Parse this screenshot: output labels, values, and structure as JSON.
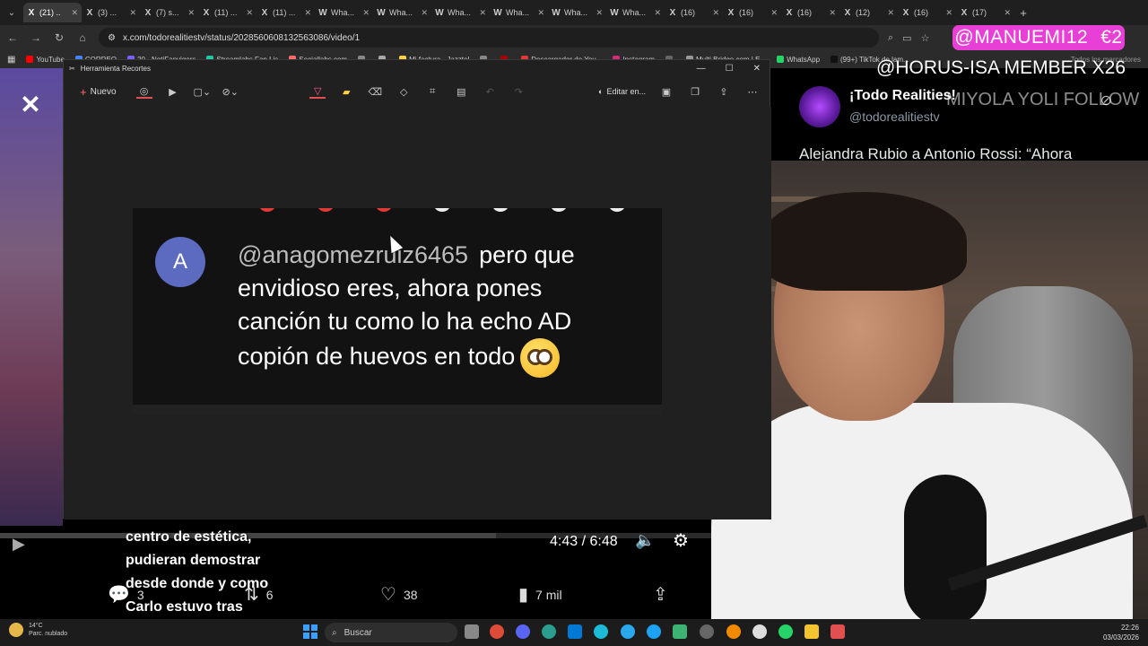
{
  "browser": {
    "tabs": [
      {
        "icon": "X",
        "label": "(21) ..",
        "active": true
      },
      {
        "icon": "X",
        "label": "(3) ..."
      },
      {
        "icon": "X",
        "label": "(7) s..."
      },
      {
        "icon": "X",
        "label": "(11) ..."
      },
      {
        "icon": "X",
        "label": "(11) ..."
      },
      {
        "icon": "W",
        "label": "Wha..."
      },
      {
        "icon": "W",
        "label": "Wha..."
      },
      {
        "icon": "W",
        "label": "Wha..."
      },
      {
        "icon": "W",
        "label": "Wha..."
      },
      {
        "icon": "W",
        "label": "Wha..."
      },
      {
        "icon": "W",
        "label": "Wha..."
      },
      {
        "icon": "X",
        "label": "(16)"
      },
      {
        "icon": "X",
        "label": "(16)"
      },
      {
        "icon": "X",
        "label": "(16)"
      },
      {
        "icon": "X",
        "label": "(12)"
      },
      {
        "icon": "X",
        "label": "(16)"
      },
      {
        "icon": "X",
        "label": "(17)"
      }
    ],
    "url": "x.com/todorealitiestv/status/2028560608132563086/video/1",
    "bookmarks": [
      "YouTube",
      "CORREO",
      "20 - NotiFanvigers",
      "Streamlabs Fan Lis",
      "Sociallabs.com",
      "",
      "",
      "Mi factura - Jazztel",
      "",
      "",
      "Descargador de You...",
      "Instagram",
      "",
      "Multi Bridge com | E...",
      "WhatsApp",
      "(99+) TikTok de lam..."
    ],
    "bookmarks_right": "Todos los marcadores"
  },
  "overlays": {
    "badge_user": "@MANUEMI12",
    "badge_amount": "€2",
    "member_line": "@HORUS-ISA  MEMBER X26",
    "follow_line": "MIYOLA YOLI  FOLLOW"
  },
  "snipping_tool": {
    "title": "Herramienta Recortes",
    "new_label": "Nuevo",
    "edit_label": "Editar en...",
    "comment": {
      "avatar_letter": "A",
      "handle": "@anagomezruiz6465",
      "line1": "pero que",
      "line2": "envidioso eres, ahora pones",
      "line3": "canción tu como lo ha echo AD",
      "line4": "copión de huevos en todo"
    }
  },
  "tweet": {
    "name": "¡Todo Realities!",
    "handle": "@todorealitiestv",
    "text": "Alejandra Rubio a Antonio Rossi: “Ahora"
  },
  "player": {
    "time": "4:43 / 6:48",
    "progress": 0.697,
    "subtitle": "centro de estética, pudieran demostrar desde donde y como Carlo estuvo tras Laura..ya veremos.",
    "replies": "3",
    "reposts": "6",
    "likes": "38",
    "views": "7 mil"
  },
  "taskbar": {
    "temp": "14°C",
    "weather": "Parc. nublado",
    "search": "Buscar",
    "time": "22:26",
    "date": "03/03/2026"
  },
  "colors": {
    "badge": "#e83fd6",
    "accent_blue": "#3aa0ff"
  }
}
